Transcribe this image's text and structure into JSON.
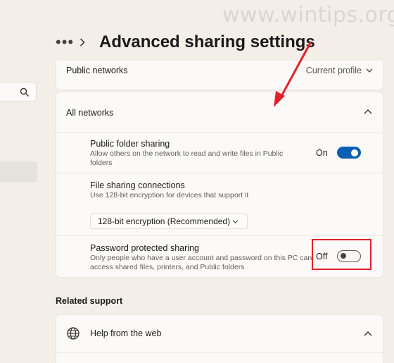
{
  "watermark": "www.wintips.org",
  "header": {
    "more_label": "•••",
    "title": "Advanced sharing settings"
  },
  "public_networks": {
    "label": "Public networks",
    "value": "Current profile"
  },
  "all_networks": {
    "label": "All networks",
    "public_folder_sharing": {
      "title": "Public folder sharing",
      "description_line1": "Allow others on the network to read and write files in Public",
      "description_line2": "folders",
      "state": "On"
    },
    "file_sharing_connections": {
      "title": "File sharing connections",
      "description": "Use 128-bit encryption for devices that support it",
      "selected": "128-bit encryption (Recommended)"
    },
    "password_protected_sharing": {
      "title": "Password protected sharing",
      "description_line1": "Only people who have a user account and password on this PC can",
      "description_line2": "access shared files, printers, and Public folders",
      "state": "Off"
    }
  },
  "related_support": {
    "heading": "Related support",
    "help_label": "Help from the web"
  },
  "colors": {
    "accent": "#0a5fb4",
    "highlight": "#e0232a",
    "background": "#f3eee8"
  }
}
